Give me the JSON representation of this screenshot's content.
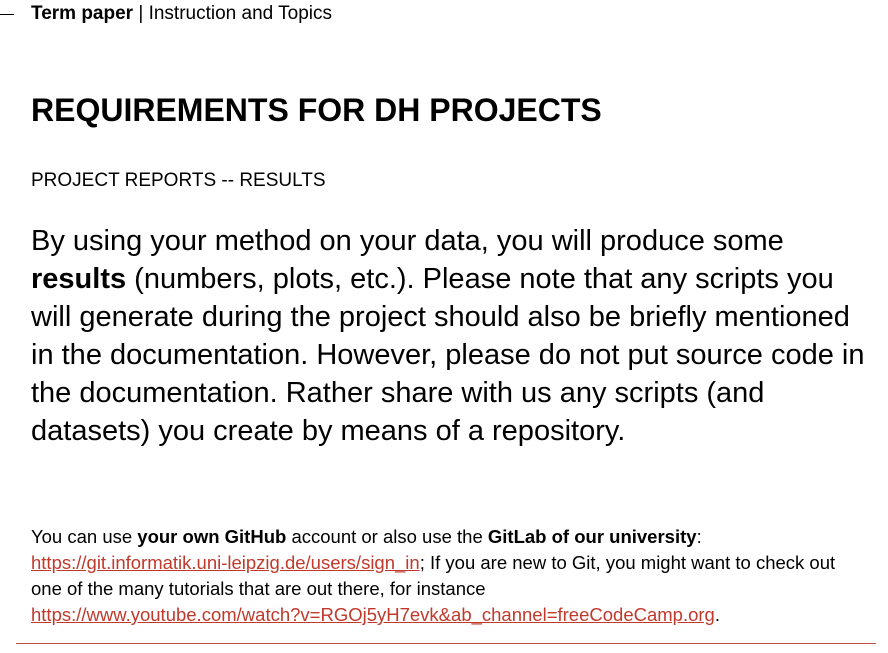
{
  "header": {
    "bold": "Term paper",
    "separator": " | ",
    "rest": "Instruction and Topics"
  },
  "title": "REQUIREMENTS FOR DH PROJECTS",
  "subtitle": "PROJECT REPORTS -- RESULTS",
  "paragraph": {
    "p1": "By using your method on your data, you will produce some ",
    "bold": "results",
    "p2": " (numbers, plots, etc.). Please note that any scripts you will generate during the project should also be briefly mentioned in the documentation. However, please do not put source code in the documentation. Rather share with us any scripts (and datasets) you create by means of a repository."
  },
  "note": {
    "t1": "You can use ",
    "b1": "your own GitHub",
    "t2": " account or also use the ",
    "b2": "GitLab of our university",
    "t3": ": ",
    "link1": "https://git.informatik.uni-leipzig.de/users/sign_in",
    "t4": "; If you are new to Git, you might want to check out one of the many tutorials that are out there, for instance ",
    "link2": "https://www.youtube.com/watch?v=RGOj5yH7evk&ab_channel=freeCodeCamp.org",
    "t5": "."
  },
  "colors": {
    "link": "#c0392b",
    "rule": "#c0504d"
  }
}
